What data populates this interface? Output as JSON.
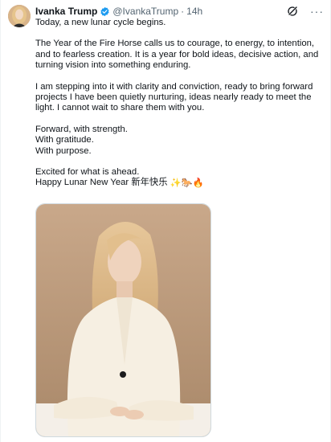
{
  "tweet": {
    "author": {
      "display_name": "Ivanka Trump",
      "handle": "@IvankaTrump",
      "separator": "·",
      "timestamp": "14h",
      "verified": true
    },
    "paragraphs": [
      [
        "Today, a new lunar cycle begins."
      ],
      [
        "The Year of the Fire Horse calls us to courage, to energy, to intention, and to fearless creation. It is a year for bold ideas, decisive action, and turning vision into something enduring."
      ],
      [
        "I am stepping into it with clarity and conviction, ready to bring forward projects I have been quietly nurturing, ideas nearly ready to meet the light. I cannot wait to share them with you."
      ],
      [
        "Forward, with strength.",
        "With gratitude.",
        "With purpose."
      ],
      [
        "Excited for what is ahead.",
        "Happy Lunar New Year 新年快乐"
      ]
    ],
    "closing_emojis": "✨🐎🔥",
    "icons": {
      "verified": "verified-badge-icon",
      "grok": "grok-icon",
      "more": "more-options-icon"
    },
    "colors": {
      "verified_blue": "#1d9bf0",
      "secondary_text": "#536471",
      "primary_text": "#0f1419"
    }
  }
}
